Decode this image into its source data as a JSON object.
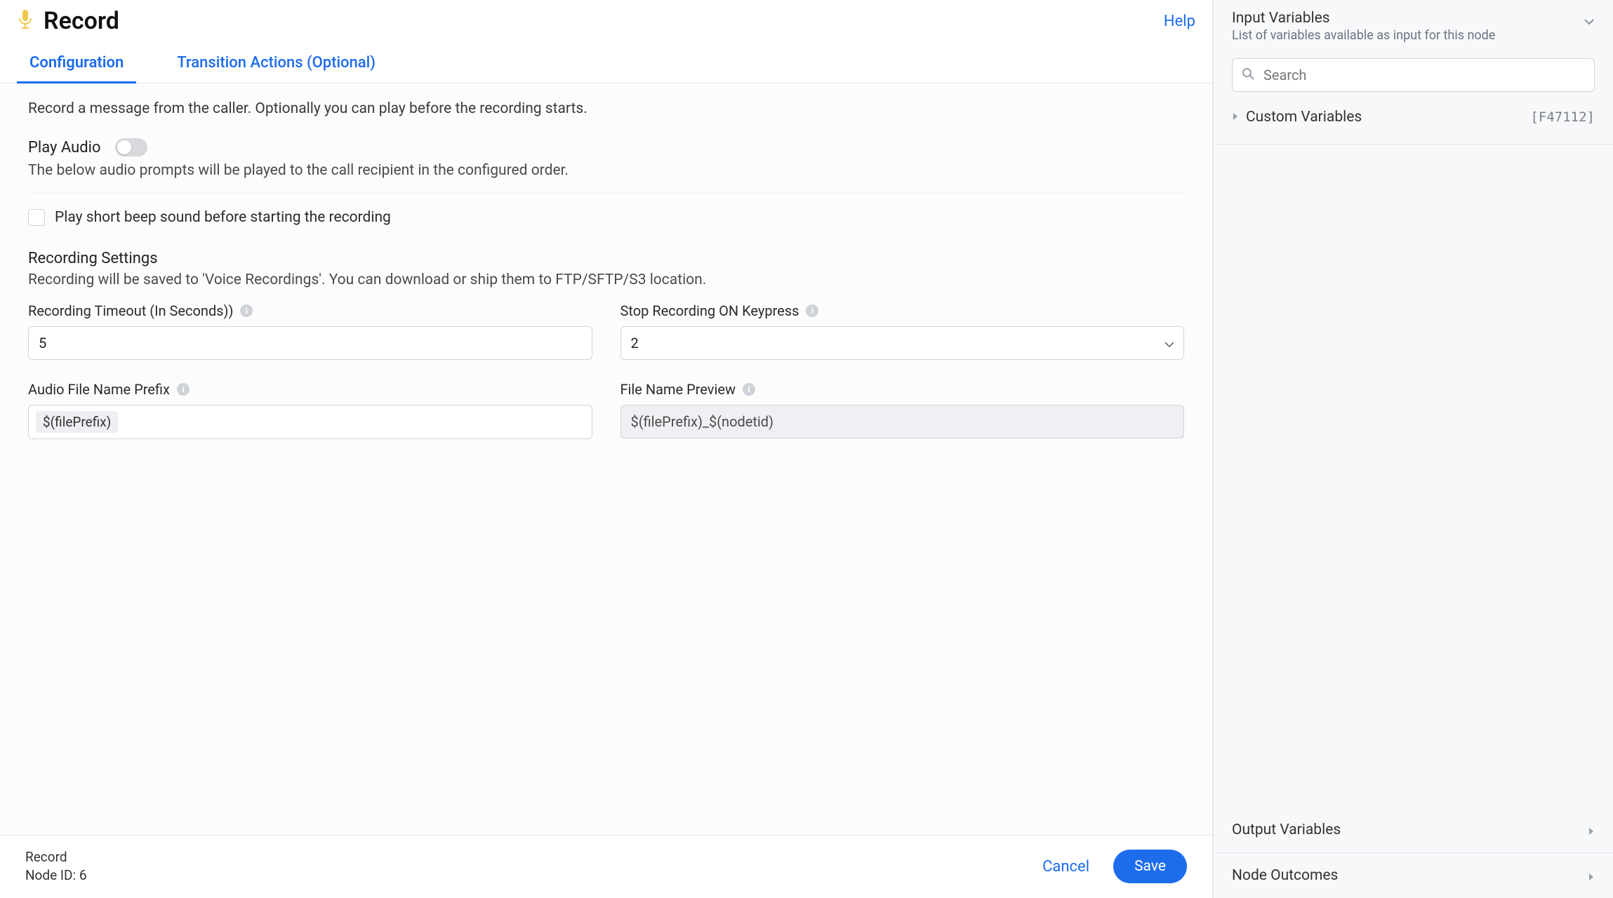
{
  "header": {
    "title": "Record",
    "help": "Help"
  },
  "tabs": {
    "configuration": "Configuration",
    "transition": "Transition Actions (Optional)"
  },
  "intro": "Record a message from the caller. Optionally you can play before the recording starts.",
  "playAudio": {
    "title": "Play Audio",
    "desc": "The below audio prompts will be played to the call recipient in the configured order."
  },
  "beep": {
    "label": "Play short beep sound before starting the recording"
  },
  "recording": {
    "title": "Recording Settings",
    "desc": "Recording will be saved to 'Voice Recordings'. You can download or ship them to FTP/SFTP/S3 location.",
    "timeoutLabel": "Recording Timeout (In Seconds))",
    "timeoutValue": "5",
    "stopKeyLabel": "Stop Recording ON Keypress",
    "stopKeyValue": "2",
    "prefixLabel": "Audio File Name Prefix",
    "prefixToken": "$(filePrefix)",
    "previewLabel": "File Name Preview",
    "previewValue": "$(filePrefix)_$(nodetid)"
  },
  "footer": {
    "name": "Record",
    "nodeId": "Node ID: 6",
    "cancel": "Cancel",
    "save": "Save"
  },
  "sidebar": {
    "input": {
      "title": "Input Variables",
      "sub": "List of variables available as input for this node",
      "searchPlaceholder": "Search",
      "customVars": "Custom Variables",
      "customVarsTag": "[F47112]"
    },
    "output": {
      "title": "Output Variables"
    },
    "outcomes": {
      "title": "Node Outcomes"
    }
  }
}
